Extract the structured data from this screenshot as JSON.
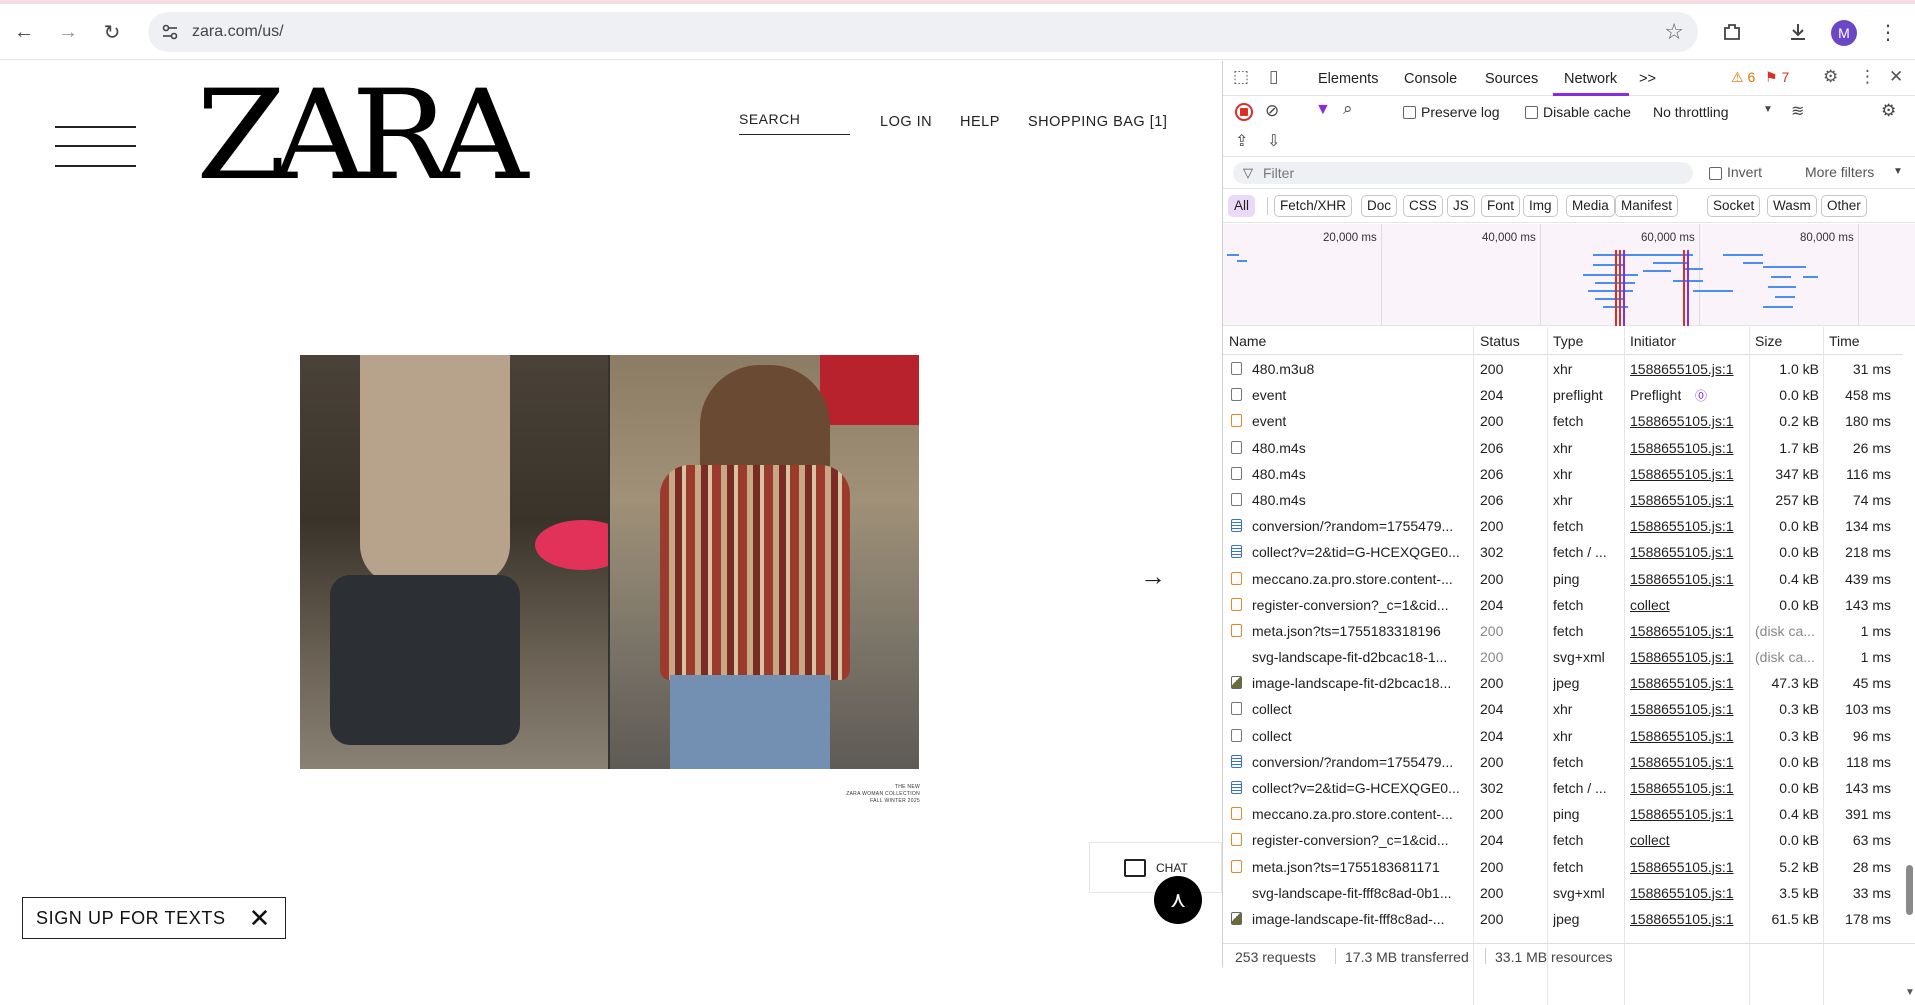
{
  "browser": {
    "url": "zara.com/us/",
    "avatar_initial": "M"
  },
  "site": {
    "logo": "ZARA",
    "search_label": "SEARCH",
    "nav": [
      "LOG IN",
      "HELP",
      "SHOPPING BAG [1]"
    ],
    "caption_lines": [
      "THE NEW",
      "ZARA WOMAN COLLECTION",
      "FALL WINTER 2025"
    ],
    "chat_label": "CHAT",
    "signup_label": "SIGN UP FOR TEXTS"
  },
  "devtools": {
    "tabs": [
      "Elements",
      "Console",
      "Sources",
      "Network"
    ],
    "active_tab": "Network",
    "more_tabs": ">>",
    "warnings": "6",
    "errors": "7",
    "preserve_log": "Preserve log",
    "disable_cache": "Disable cache",
    "throttling": "No throttling",
    "filter_placeholder": "Filter",
    "invert": "Invert",
    "more_filters": "More filters",
    "chips": [
      "All",
      "Fetch/XHR",
      "Doc",
      "CSS",
      "JS",
      "Font",
      "Img",
      "Media",
      "Manifest",
      "Socket",
      "Wasm",
      "Other"
    ],
    "timeline_labels": [
      "20,000 ms",
      "40,000 ms",
      "60,000 ms",
      "80,000 ms"
    ],
    "columns": [
      "Name",
      "Status",
      "Type",
      "Initiator",
      "Size",
      "Time"
    ],
    "rows": [
      {
        "icon": "file",
        "name": "480.m3u8",
        "status": "200",
        "type": "xhr",
        "initiator": "1588655105.js:1",
        "size": "1.0 kB",
        "time": "31 ms"
      },
      {
        "icon": "file",
        "name": "event",
        "status": "204",
        "type": "preflight",
        "initiator": "Preflight",
        "size": "0.0 kB",
        "time": "458 ms"
      },
      {
        "icon": "script",
        "name": "event",
        "status": "200",
        "type": "fetch",
        "initiator": "1588655105.js:1",
        "size": "0.2 kB",
        "time": "180 ms"
      },
      {
        "icon": "file",
        "name": "480.m4s",
        "status": "206",
        "type": "xhr",
        "initiator": "1588655105.js:1",
        "size": "1.7 kB",
        "time": "26 ms"
      },
      {
        "icon": "file",
        "name": "480.m4s",
        "status": "206",
        "type": "xhr",
        "initiator": "1588655105.js:1",
        "size": "347 kB",
        "time": "116 ms"
      },
      {
        "icon": "file",
        "name": "480.m4s",
        "status": "206",
        "type": "xhr",
        "initiator": "1588655105.js:1",
        "size": "257 kB",
        "time": "74 ms"
      },
      {
        "icon": "doc",
        "name": "conversion/?random=1755479...",
        "status": "200",
        "type": "fetch",
        "initiator": "1588655105.js:1",
        "size": "0.0 kB",
        "time": "134 ms"
      },
      {
        "icon": "doc",
        "name": "collect?v=2&tid=G-HCEXQGE0...",
        "status": "302",
        "type": "fetch / ...",
        "initiator": "1588655105.js:1",
        "size": "0.0 kB",
        "time": "218 ms"
      },
      {
        "icon": "script",
        "name": "meccano.za.pro.store.content-...",
        "status": "200",
        "type": "ping",
        "initiator": "1588655105.js:1",
        "size": "0.4 kB",
        "time": "439 ms"
      },
      {
        "icon": "script",
        "name": "register-conversion?_c=1&cid...",
        "status": "204",
        "type": "fetch",
        "initiator": "collect",
        "size": "0.0 kB",
        "time": "143 ms"
      },
      {
        "icon": "script",
        "name": "meta.json?ts=1755183318196",
        "status": "200",
        "type": "fetch",
        "initiator": "1588655105.js:1",
        "size": "(disk ca...",
        "time": "1 ms",
        "gray": true
      },
      {
        "icon": "none",
        "name": "svg-landscape-fit-d2bcac18-1...",
        "status": "200",
        "type": "svg+xml",
        "initiator": "1588655105.js:1",
        "size": "(disk ca...",
        "time": "1 ms",
        "gray": true
      },
      {
        "icon": "img",
        "name": "image-landscape-fit-d2bcac18...",
        "status": "200",
        "type": "jpeg",
        "initiator": "1588655105.js:1",
        "size": "47.3 kB",
        "time": "45 ms"
      },
      {
        "icon": "file",
        "name": "collect",
        "status": "204",
        "type": "xhr",
        "initiator": "1588655105.js:1",
        "size": "0.3 kB",
        "time": "103 ms"
      },
      {
        "icon": "file",
        "name": "collect",
        "status": "204",
        "type": "xhr",
        "initiator": "1588655105.js:1",
        "size": "0.3 kB",
        "time": "96 ms"
      },
      {
        "icon": "doc",
        "name": "conversion/?random=1755479...",
        "status": "200",
        "type": "fetch",
        "initiator": "1588655105.js:1",
        "size": "0.0 kB",
        "time": "118 ms"
      },
      {
        "icon": "doc",
        "name": "collect?v=2&tid=G-HCEXQGE0...",
        "status": "302",
        "type": "fetch / ...",
        "initiator": "1588655105.js:1",
        "size": "0.0 kB",
        "time": "143 ms"
      },
      {
        "icon": "script",
        "name": "meccano.za.pro.store.content-...",
        "status": "200",
        "type": "ping",
        "initiator": "1588655105.js:1",
        "size": "0.4 kB",
        "time": "391 ms"
      },
      {
        "icon": "script",
        "name": "register-conversion?_c=1&cid...",
        "status": "204",
        "type": "fetch",
        "initiator": "collect",
        "size": "0.0 kB",
        "time": "63 ms"
      },
      {
        "icon": "script",
        "name": "meta.json?ts=1755183681171",
        "status": "200",
        "type": "fetch",
        "initiator": "1588655105.js:1",
        "size": "5.2 kB",
        "time": "28 ms"
      },
      {
        "icon": "none",
        "name": "svg-landscape-fit-fff8c8ad-0b1...",
        "status": "200",
        "type": "svg+xml",
        "initiator": "1588655105.js:1",
        "size": "3.5 kB",
        "time": "33 ms"
      },
      {
        "icon": "img",
        "name": "image-landscape-fit-fff8c8ad-...",
        "status": "200",
        "type": "jpeg",
        "initiator": "1588655105.js:1",
        "size": "61.5 kB",
        "time": "178 ms"
      }
    ],
    "summary": [
      "253 requests",
      "17.3 MB transferred",
      "33.1 MB resources"
    ]
  }
}
